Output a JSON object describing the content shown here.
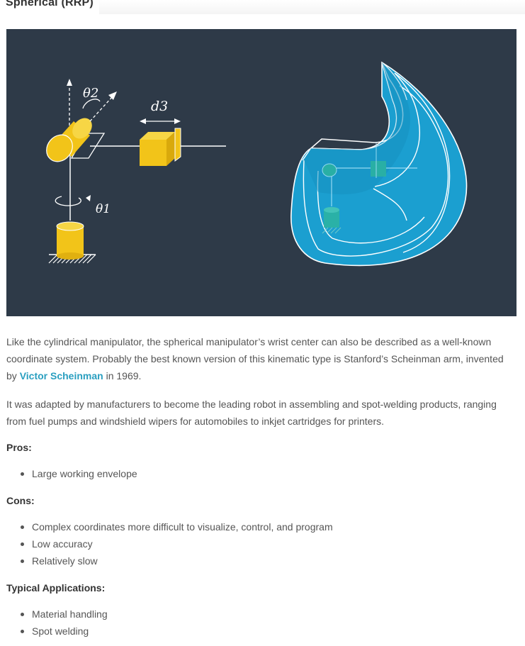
{
  "section": {
    "title": "Spherical (RRP)"
  },
  "figure": {
    "labels": {
      "theta2": "θ2",
      "theta1": "θ1",
      "d3": "d3"
    },
    "colors": {
      "background": "#2e3a48",
      "joint": "#f2c419",
      "envelope": "#1b9fd0",
      "line": "#ffffff"
    }
  },
  "body": {
    "para1_before": "Like the cylindrical manipulator, the spherical manipulator’s wrist center can also be described as a well-known coordinate system. Probably the best known version of this kinematic type is Stanford’s Scheinman arm, invented by ",
    "para1_link": "Victor Scheinman",
    "para1_after": " in 1969.",
    "para2": "It was adapted by manufacturers to become the leading robot in assembling and spot-welding products, ranging from fuel pumps and windshield wipers for automobiles to inkjet cartridges for printers."
  },
  "pros": {
    "label": "Pros:",
    "items": [
      "Large working envelope"
    ]
  },
  "cons": {
    "label": "Cons:",
    "items": [
      "Complex coordinates more difficult to visualize, control, and program",
      "Low accuracy",
      "Relatively slow"
    ]
  },
  "applications": {
    "label": "Typical Applications:",
    "items": [
      "Material handling",
      "Spot welding"
    ]
  }
}
